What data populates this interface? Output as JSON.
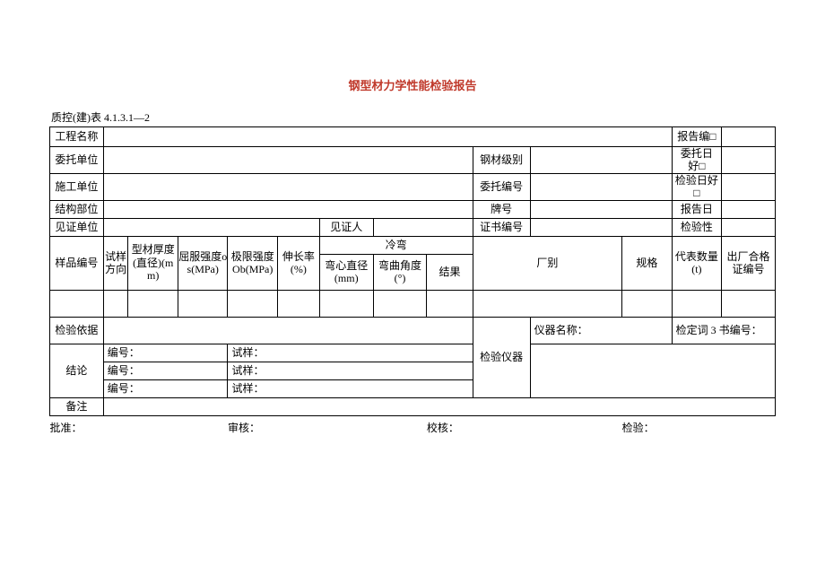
{
  "title": "钢型材力学性能检验报告",
  "subtitle": "质控(建)表 4.1.3.1—2",
  "rows": {
    "project_name_label": "工程名称",
    "project_name_value": "",
    "report_no_label": "报告编□",
    "report_no_value": "",
    "client_label": "委托单位",
    "client_value": "",
    "steel_grade_label": "钢材级别",
    "steel_grade_value": "",
    "entrust_date_label": "委托日\n好□",
    "entrust_date_value": "",
    "builder_label": "施工单位",
    "builder_value": "",
    "entrust_no_label": "委托编号",
    "entrust_no_value": "",
    "inspect_date_label": "检验日好\n□",
    "inspect_date_value": "",
    "structure_label": "结构部位",
    "structure_value": "",
    "brand_label": "牌号",
    "brand_value": "",
    "report_date_label": "报告日",
    "report_date_value": "",
    "witness_unit_label": "见证单位",
    "witness_unit_value": "",
    "witness_person_label": "见证人",
    "witness_person_value": "",
    "cert_no_label": "证书编号",
    "cert_no_value": "",
    "inspect_type_label": "检验性",
    "inspect_type_value": ""
  },
  "columns": {
    "sample_no": "样品编号",
    "sample_dir": "试样方向",
    "thickness": "型材厚度(直径)(mm)",
    "yield": "屈服强度os(MPa)",
    "ultimate": "极限强度Ob(MPa)",
    "elongation": "伸长率(%)",
    "cold_bend": "冷弯",
    "bend_dia": "弯心直径(mm)",
    "bend_angle": "弯曲角度(°)",
    "result": "结果",
    "factory": "厂别",
    "spec": "规格",
    "rep_qty": "代表数量(t)",
    "factory_cert": "出厂合格证编号"
  },
  "data_row": {
    "sample_no": "",
    "sample_dir": "",
    "thickness": "",
    "yield": "",
    "ultimate": "",
    "elongation": "",
    "bend_dia": "",
    "bend_angle": "",
    "result": "",
    "factory": "",
    "spec": "",
    "rep_qty": "",
    "factory_cert": ""
  },
  "basis_label": "检验依据",
  "basis_value": "",
  "instrument_side_label": "检验仪器",
  "instrument_row1_left": "仪器名称：",
  "instrument_row1_right": "检定词 3 书编号：",
  "conclusion_label": "结论",
  "conclusion_rows": [
    {
      "no": "编号：",
      "sample": "试样："
    },
    {
      "no": "编号：",
      "sample": "试样："
    },
    {
      "no": "编号：",
      "sample": "试样："
    }
  ],
  "remark_label": "备注",
  "remark_value": "",
  "footer": {
    "approve": "批准：",
    "review": "审核：",
    "check": "校核：",
    "inspect": "检验："
  }
}
